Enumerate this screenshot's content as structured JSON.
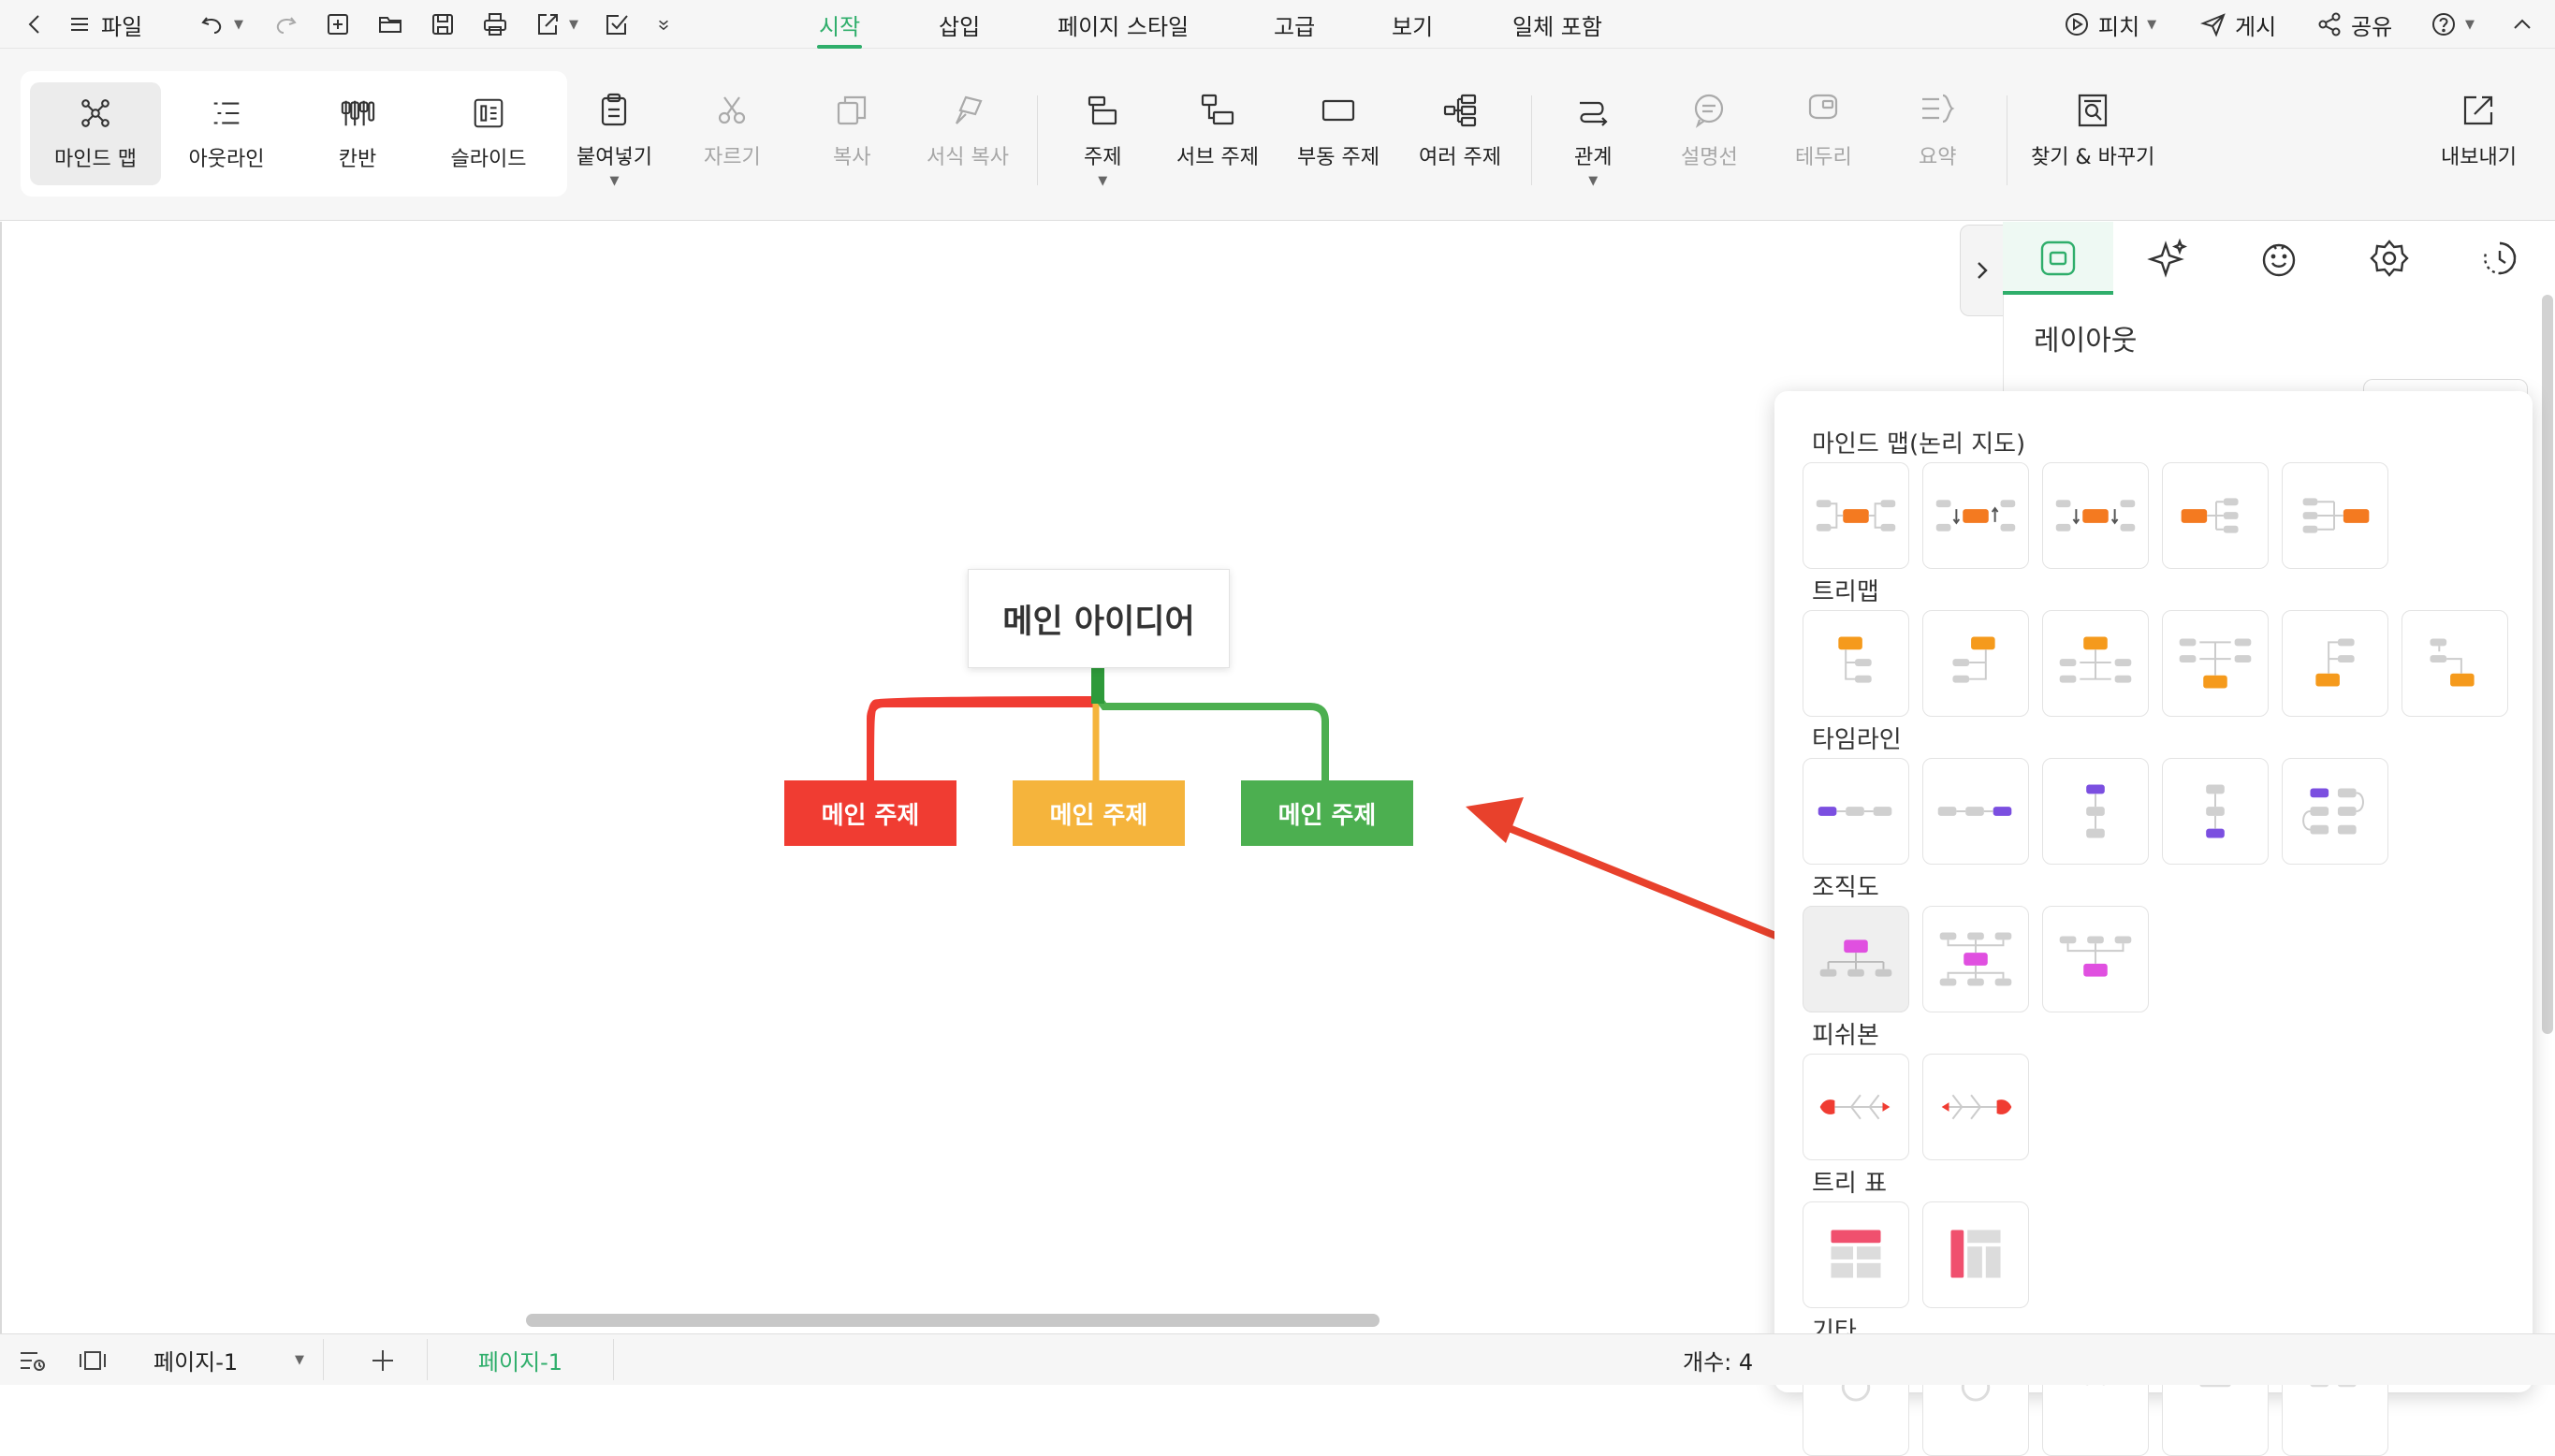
{
  "menubar": {
    "file_label": "파일",
    "tabs": [
      "시작",
      "삽입",
      "페이지 스타일",
      "고급",
      "보기",
      "일체 포함"
    ],
    "active_tab": "시작",
    "pitch_label": "피치",
    "publish_label": "게시",
    "share_label": "공유",
    "accent_color": "#2fae6b"
  },
  "toolbar": {
    "modes": [
      "마인드 맵",
      "아웃라인",
      "칸반",
      "슬라이드"
    ],
    "selected_mode": "마인드 맵",
    "paste": "붙여넣기",
    "cut": "자르기",
    "copy": "복사",
    "format_copy": "서식 복사",
    "topic": "주제",
    "subtopic": "서브 주제",
    "floating_topic": "부동 주제",
    "multiple_topics": "여러 주제",
    "relationship": "관계",
    "callout": "설명선",
    "boundary": "테두리",
    "summary": "요약",
    "find_replace": "찾기 & 바꾸기",
    "export": "내보내기"
  },
  "canvas": {
    "main_idea": "메인 아이디어",
    "topics": [
      {
        "label": "메인 주제",
        "color": "#f03c32"
      },
      {
        "label": "메인 주제",
        "color": "#f5b43c"
      },
      {
        "label": "메인 주제",
        "color": "#4caf50"
      }
    ],
    "arrow_color": "#e8412c"
  },
  "statusbar": {
    "page_select": "페이지-1",
    "page_tab": "페이지-1",
    "count_label": "개수: 4"
  },
  "sidepanel": {
    "tab_icons": [
      "layout-icon",
      "sparkle-icon",
      "emoji-icon",
      "badge-icon",
      "clock-icon"
    ],
    "title": "레이아웃"
  },
  "layout_popup": {
    "categories": [
      {
        "label": "마인드 맵(논리 지도)",
        "tiles": 5
      },
      {
        "label": "트리맵",
        "tiles": 6
      },
      {
        "label": "타임라인",
        "tiles": 5
      },
      {
        "label": "조직도",
        "tiles": 3
      },
      {
        "label": "피쉬본",
        "tiles": 2
      },
      {
        "label": "트리 표",
        "tiles": 2
      },
      {
        "label": "기타",
        "tiles": 5
      }
    ]
  }
}
